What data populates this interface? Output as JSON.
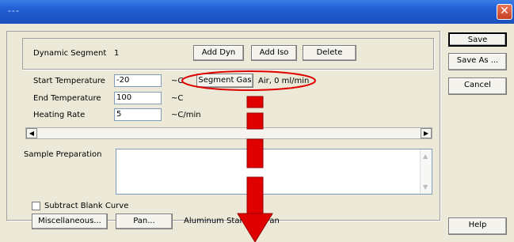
{
  "window": {
    "title": "---",
    "close_glyph": "✕"
  },
  "segment": {
    "label": "Dynamic Segment",
    "number": "1",
    "add_dyn": "Add Dyn",
    "add_iso": "Add Iso",
    "delete": "Delete"
  },
  "fields": {
    "start_temp_label": "Start Temperature",
    "start_temp_value": "-20",
    "start_temp_unit": "~C",
    "end_temp_label": "End Temperature",
    "end_temp_value": "100",
    "end_temp_unit": "~C",
    "heating_rate_label": "Heating Rate",
    "heating_rate_value": "5",
    "heating_rate_unit": "~C/min"
  },
  "segment_gas": {
    "button": "Segment Gas",
    "value": "Air, 0 ml/min"
  },
  "sample": {
    "label": "Sample Preparation"
  },
  "subtract": {
    "label": "Subtract Blank Curve"
  },
  "bottom": {
    "misc": "Miscellaneous...",
    "pan": "Pan...",
    "pan_value": "Aluminum Standard Pan"
  },
  "side_buttons": {
    "save": "Save",
    "save_as": "Save As ...",
    "cancel": "Cancel",
    "help": "Help"
  },
  "colors": {
    "highlight": "#e00000",
    "title_bar": "#2663d6"
  },
  "icons": {
    "close": "close-icon",
    "left": "arrow-left-icon",
    "right": "arrow-right-icon",
    "up": "arrow-up-icon",
    "down": "arrow-down-icon"
  }
}
